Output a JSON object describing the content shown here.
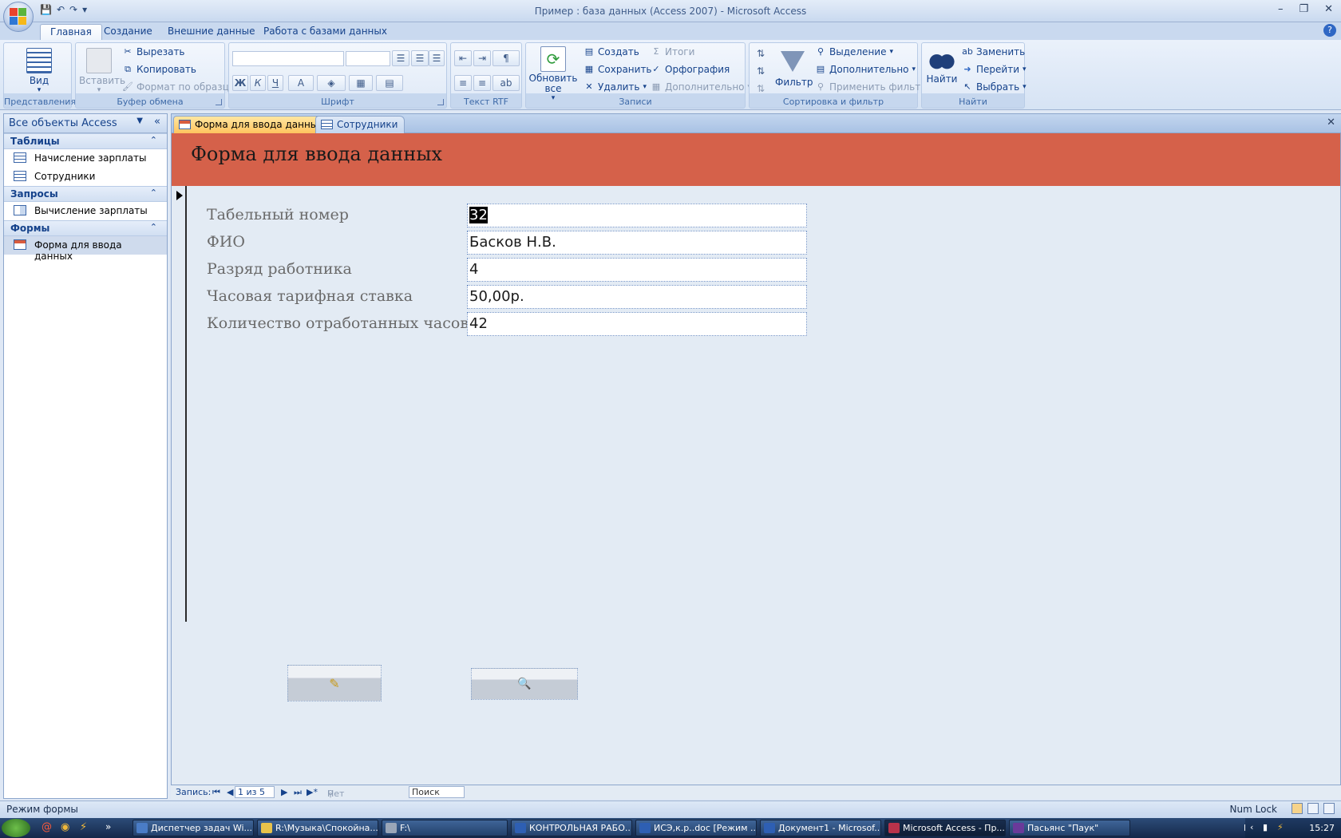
{
  "window": {
    "title": "Пример : база данных (Access 2007) - Microsoft Access",
    "controls": {
      "minimize": "–",
      "maximize": "❐",
      "close": "✕"
    }
  },
  "ribbon_tabs": [
    {
      "label": "Главная",
      "active": true
    },
    {
      "label": "Создание"
    },
    {
      "label": "Внешние данные"
    },
    {
      "label": "Работа с базами данных"
    }
  ],
  "ribbon": {
    "views": {
      "label": "Представления",
      "view_btn": "Вид"
    },
    "clipboard": {
      "label": "Буфер обмена",
      "paste": "Вставить",
      "cut": "Вырезать",
      "copy": "Копировать",
      "format_painter": "Формат по образцу"
    },
    "font": {
      "label": "Шрифт",
      "bold": "Ж",
      "italic": "К",
      "underline": "Ч",
      "font_color": "A"
    },
    "rtf": {
      "label": "Текст RTF"
    },
    "records": {
      "label": "Записи",
      "refresh": "Обновить все",
      "new": "Создать",
      "save": "Сохранить",
      "delete": "Удалить",
      "totals": "Итоги",
      "spelling": "Орфография",
      "more": "Дополнительно"
    },
    "sort_filter": {
      "label": "Сортировка и фильтр",
      "filter": "Фильтр",
      "selection": "Выделение",
      "advanced": "Дополнительно",
      "toggle_filter": "Применить фильтр"
    },
    "find": {
      "label": "Найти",
      "find": "Найти",
      "replace": "Заменить",
      "goto": "Перейти",
      "select": "Выбрать"
    }
  },
  "nav": {
    "header": "Все объекты Access",
    "groups": [
      {
        "title": "Таблицы",
        "items": [
          "Начисление зарплаты",
          "Сотрудники"
        ]
      },
      {
        "title": "Запросы",
        "items": [
          "Вычисление зарплаты"
        ]
      },
      {
        "title": "Формы",
        "items": [
          "Форма для ввода данных"
        ]
      }
    ]
  },
  "doc_tabs": [
    {
      "label": "Форма для ввода данных",
      "active": true
    },
    {
      "label": "Сотрудники"
    }
  ],
  "form": {
    "title": "Форма для ввода данных",
    "fields": [
      {
        "label": "Табельный номер",
        "value": "32"
      },
      {
        "label": "ФИО",
        "value": "Басков Н.В."
      },
      {
        "label": "Разряд работника",
        "value": "4"
      },
      {
        "label": "Часовая тарифная ставка",
        "value": "50,00р."
      },
      {
        "label": "Количество отработанных часов",
        "value": "42"
      }
    ]
  },
  "record_nav": {
    "label": "Запись:",
    "position": "1 из 5",
    "filter": "Нет фильтра",
    "search": "Поиск"
  },
  "status": {
    "mode": "Режим формы",
    "numlock": "Num Lock"
  },
  "taskbar": {
    "items": [
      "Диспетчер задач Wi...",
      "R:\\Музыка\\Спокойна...",
      "F:\\",
      "КОНТРОЛЬНАЯ РАБО...",
      "ИСЭ,к.р..doc [Режим ...",
      "Документ1 - Microsof...",
      "Microsoft Access - Пр...",
      "Пасьянс \"Паук\""
    ],
    "lang": "RU",
    "time": "15:27"
  },
  "colors": {
    "form_header": "#d5614a",
    "ribbon": "#dfe8f5",
    "active_tab": "#ffc45e"
  }
}
